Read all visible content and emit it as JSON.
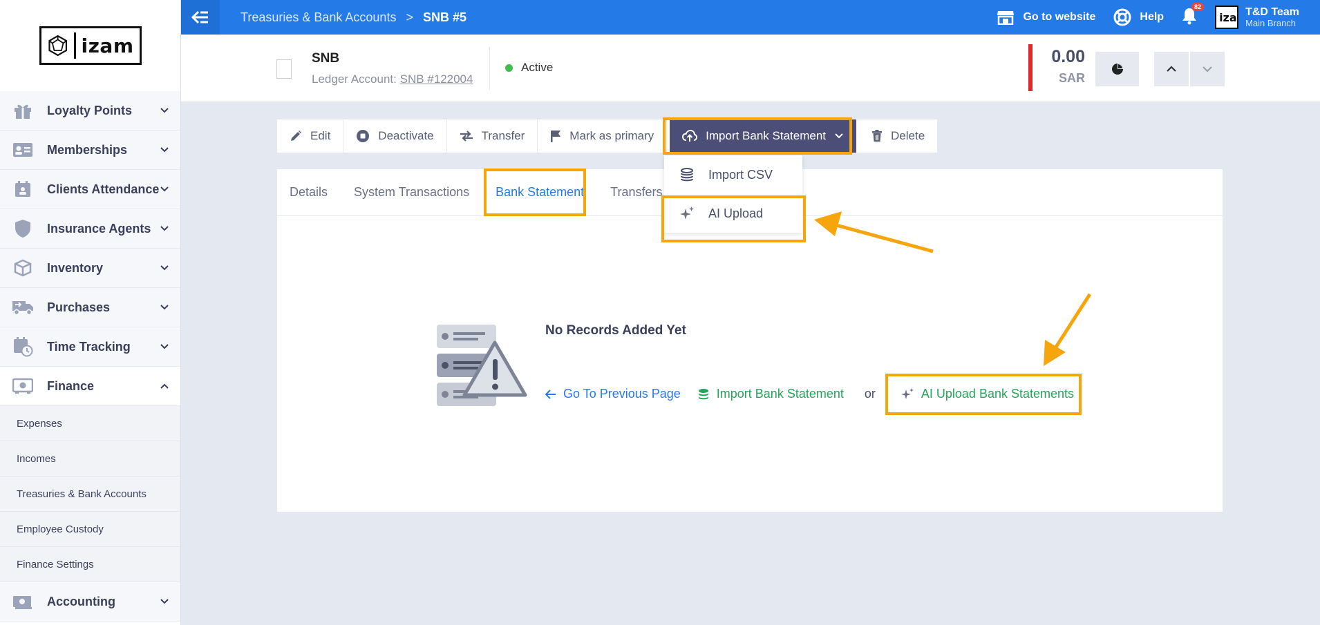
{
  "sidebar": {
    "logo_text": "izam",
    "items": [
      {
        "label": "Loyalty Points",
        "icon": "gift-icon"
      },
      {
        "label": "Memberships",
        "icon": "id-card-icon"
      },
      {
        "label": "Clients Attendance",
        "icon": "calendar-user-icon"
      },
      {
        "label": "Insurance Agents",
        "icon": "shield-icon"
      },
      {
        "label": "Inventory",
        "icon": "box-icon"
      },
      {
        "label": "Purchases",
        "icon": "truck-icon"
      },
      {
        "label": "Time Tracking",
        "icon": "calendar-clock-icon"
      },
      {
        "label": "Finance",
        "icon": "safe-icon"
      }
    ],
    "finance_sub": [
      "Expenses",
      "Incomes",
      "Treasuries & Bank Accounts",
      "Employee Custody",
      "Finance Settings"
    ],
    "accounting": "Accounting"
  },
  "topbar": {
    "breadcrumb_parent": "Treasuries & Bank Accounts",
    "breadcrumb_sep": ">",
    "breadcrumb_current": "SNB #5",
    "go_to_website": "Go to website",
    "help": "Help",
    "notification_count": "82",
    "user_logo": "iza",
    "user_name": "T&D Team",
    "user_branch": "Main Branch"
  },
  "header": {
    "account_name": "SNB",
    "ledger_label": "Ledger Account:",
    "ledger_link": "SNB #122004",
    "status": "Active",
    "balance": "0.00",
    "currency": "SAR"
  },
  "actions": {
    "edit": "Edit",
    "deactivate": "Deactivate",
    "transfer": "Transfer",
    "mark_primary": "Mark as primary",
    "import": "Import Bank Statement",
    "delete": "Delete"
  },
  "dropdown": {
    "import_csv": "Import CSV",
    "ai_upload": "AI Upload"
  },
  "tabs": [
    "Details",
    "System Transactions",
    "Bank Statement",
    "Transfers"
  ],
  "empty_state": {
    "title": "No Records Added Yet",
    "prev": "Go To Previous Page",
    "import": "Import Bank Statement",
    "or": "or",
    "ai_upload": "AI Upload Bank Statements"
  },
  "colors": {
    "topbar": "#247be8",
    "highlight": "#f7a50c",
    "import_button": "#4b4f78",
    "link_green": "#22a65a",
    "balance_bar": "#e3262d"
  }
}
